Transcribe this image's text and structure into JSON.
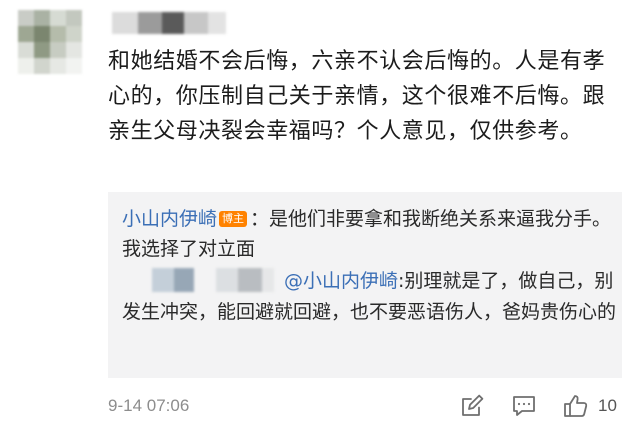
{
  "comment": {
    "text": "和她结婚不会后悔，六亲不认会后悔的。人是有孝心的，你压制自己关于亲情，这个很难不后悔。跟亲生父母决裂会幸福吗？个人意见，仅供参考。"
  },
  "replies": [
    {
      "author": "小山内伊崎",
      "badge": "博主",
      "separator": "：",
      "text": "是他们非要拿和我断绝关系来逼我分手。我选择了对立面"
    },
    {
      "mention": "@小山内伊崎",
      "separator": ":",
      "text": "别理就是了，做自己，别发生冲突，能回避就回避，也不要恶语伤人，爸妈贵伤心的"
    }
  ],
  "footer": {
    "timestamp": "9-14 07:06",
    "like_count": "10",
    "icons": [
      "edit-icon",
      "comment-icon",
      "like-icon"
    ]
  },
  "colors": {
    "link": "#3b6fb6",
    "badge": "#ff8200",
    "reply_bg": "#f3f3f4",
    "meta_text": "#8d8d8d"
  }
}
